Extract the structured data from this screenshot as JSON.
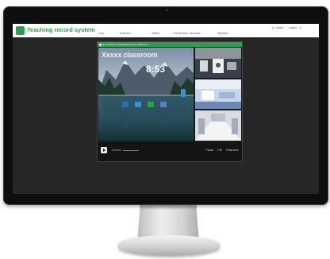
{
  "app": {
    "logo_text": "logo",
    "title": "Teaching record system"
  },
  "nav": {
    "items": [
      "Live",
      "Director",
      "Video",
      "Curriculum account",
      "System"
    ]
  },
  "user": {
    "name": "admin",
    "logout_label": "logout"
  },
  "player": {
    "status_text": "Recording & broadcasting demo classroom",
    "room_label": "Xxxxx classroom",
    "clock": "8:53",
    "volume_label": "Volume",
    "controls": [
      "Pause",
      "Full",
      "Fullscreen"
    ]
  },
  "colors": {
    "accent": "#2e9d4f",
    "header_bg": "#ffffff",
    "screen_bg": "#262626",
    "bezel": "#0e0e0e"
  }
}
